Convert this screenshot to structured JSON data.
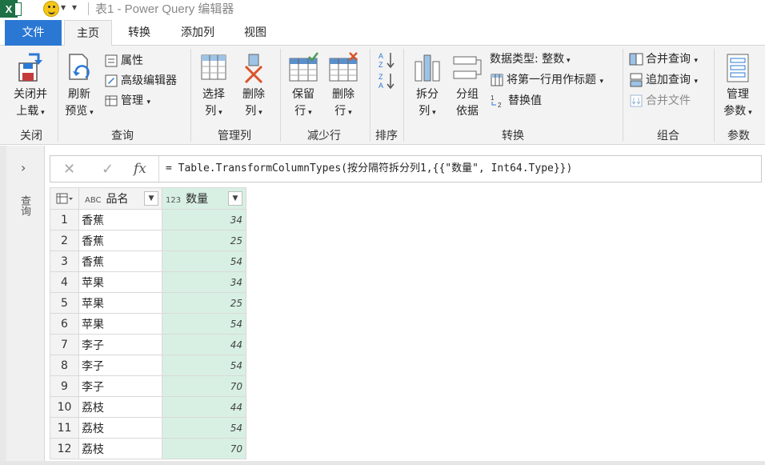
{
  "app": {
    "title": "表1 - Power Query 编辑器",
    "logo_letter": "X"
  },
  "tabs": [
    {
      "label": "文件"
    },
    {
      "label": "主页"
    },
    {
      "label": "转换"
    },
    {
      "label": "添加列"
    },
    {
      "label": "视图"
    }
  ],
  "ribbon": {
    "close": {
      "btn_line1": "关闭并",
      "btn_line2": "上载",
      "group": "关闭"
    },
    "query": {
      "refresh_line1": "刷新",
      "refresh_line2": "预览",
      "properties": "属性",
      "advanced_editor": "高级编辑器",
      "manage": "管理",
      "group": "查询"
    },
    "manage_cols": {
      "choose_line1": "选择",
      "choose_line2": "列",
      "remove_line1": "删除",
      "remove_line2": "列",
      "group": "管理列"
    },
    "reduce_rows": {
      "keep_line1": "保留",
      "keep_line2": "行",
      "remove_line1": "删除",
      "remove_line2": "行",
      "group": "减少行"
    },
    "sort": {
      "group": "排序"
    },
    "transform": {
      "split_line1": "拆分",
      "split_line2": "列",
      "group_line1": "分组",
      "group_line2": "依据",
      "data_type": "数据类型: 整数",
      "first_row_header": "将第一行用作标题",
      "replace_values": "替换值",
      "group": "转换"
    },
    "combine": {
      "merge": "合并查询",
      "append": "追加查询",
      "combine_files": "合并文件",
      "group": "组合"
    },
    "params": {
      "btn_line1": "管理",
      "btn_line2": "参数",
      "group": "参数"
    }
  },
  "left_pane": {
    "label": "查询"
  },
  "formula_bar": {
    "cancel_icon": "✕",
    "commit_icon": "✓",
    "fx": "fx",
    "formula": "= Table.TransformColumnTypes(按分隔符拆分列1,{{\"数量\", Int64.Type}})"
  },
  "grid": {
    "columns": [
      {
        "type_badge": "ABC",
        "name": "品名"
      },
      {
        "type_badge": "123",
        "name": "数量"
      }
    ],
    "rows": [
      {
        "idx": "1",
        "name": "香蕉",
        "qty": "34"
      },
      {
        "idx": "2",
        "name": "香蕉",
        "qty": "25"
      },
      {
        "idx": "3",
        "name": "香蕉",
        "qty": "54"
      },
      {
        "idx": "4",
        "name": "苹果",
        "qty": "34"
      },
      {
        "idx": "5",
        "name": "苹果",
        "qty": "25"
      },
      {
        "idx": "6",
        "name": "苹果",
        "qty": "54"
      },
      {
        "idx": "7",
        "name": "李子",
        "qty": "44"
      },
      {
        "idx": "8",
        "name": "李子",
        "qty": "54"
      },
      {
        "idx": "9",
        "name": "李子",
        "qty": "70"
      },
      {
        "idx": "10",
        "name": "荔枝",
        "qty": "44"
      },
      {
        "idx": "11",
        "name": "荔枝",
        "qty": "54"
      },
      {
        "idx": "12",
        "name": "荔枝",
        "qty": "70"
      }
    ]
  },
  "colors": {
    "accent": "#2b78d4",
    "excel_green": "#1e7145",
    "number_col_bg": "#d8f0e3"
  }
}
